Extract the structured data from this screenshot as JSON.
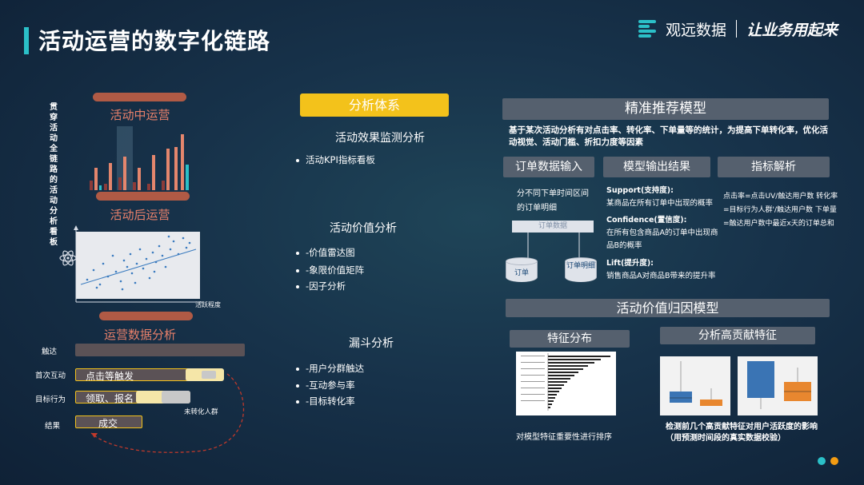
{
  "header": {
    "title": "活动运营的数字化链路",
    "logo_text": "观远数据",
    "slogan": "让业务用起来"
  },
  "left": {
    "vertical_label": "贯穿活动全链路的活动分析看板",
    "sections": [
      "活动中运营",
      "活动后运营",
      "运营数据分析"
    ],
    "scatter_axis_label": "活跃程度",
    "funnel": {
      "rows": [
        "触达",
        "首次互动",
        "目标行为",
        "结果"
      ],
      "bars": [
        "点击等触发",
        "领取、报名",
        "成交"
      ],
      "note": "未转化人群"
    }
  },
  "middle": {
    "tag": "分析体系",
    "groups": [
      {
        "title": "活动效果监测分析",
        "items": [
          "活动KPI指标看板"
        ]
      },
      {
        "title": "活动价值分析",
        "items": [
          "-价值雷达图",
          "-象限价值矩阵",
          "-因子分析"
        ]
      },
      {
        "title": "漏斗分析",
        "items": [
          "-用户分群触达",
          "-互动参与率",
          "-目标转化率"
        ]
      }
    ]
  },
  "right": {
    "model1": {
      "title": "精准推荐模型",
      "desc": "基于某次活动分析有对点击率、转化率、下单量等的统计，为提高下单转化率，优化活动视觉、活动门槛、折扣力度等因素",
      "cols": [
        "订单数据输入",
        "模型输出结果",
        "指标解析"
      ],
      "input_text": "分不同下单时间区间的订单明细",
      "input_box": "订单数据",
      "cyl1": "订单",
      "cyl2": "订单明细",
      "outputs": [
        {
          "head": "Support(支持度):",
          "text": "某商品在所有订单中出现的概率"
        },
        {
          "head": "Confidence(置信度):",
          "text": "在所有包含商品A的订单中出现商品B的概率"
        },
        {
          "head": "Lift(提升度):",
          "text": "销售商品A对商品B带来的提升率"
        }
      ],
      "metrics": "点击率=点击UV/触达用户数 转化率=目标行为人群'/触达用户数 下单量=触达用户数中最近x天的订单总和"
    },
    "model2": {
      "title": "活动价值归因模型",
      "sub1": "特征分布",
      "sub2": "分析高贡献特征",
      "cap1": "对模型特征重要性进行排序",
      "cap2": "检测前几个高贡献特征对用户活跃度的影响（用预测时间段的真实数据校验）"
    }
  },
  "colors": {
    "accent": "#2bc0c8",
    "orange": "#f39c12",
    "tag_yellow": "#f3c21b"
  }
}
